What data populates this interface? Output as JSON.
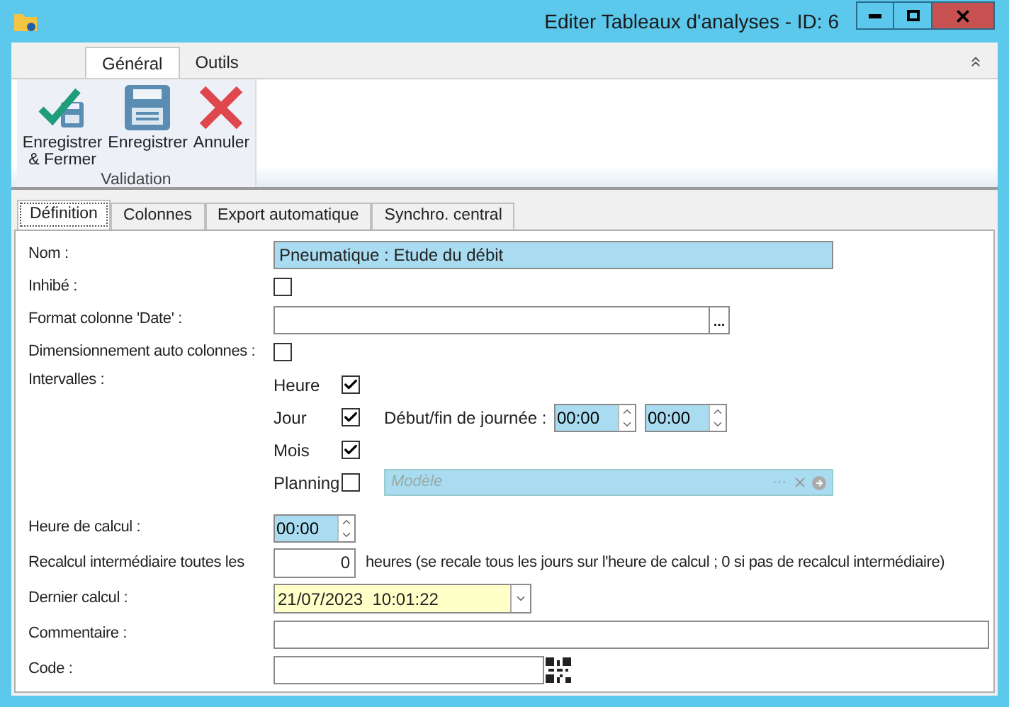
{
  "window": {
    "title": "Editer Tableaux d'analyses - ID: 6"
  },
  "ribbon": {
    "tabs": [
      {
        "label": "Général",
        "selected": true
      },
      {
        "label": "Outils",
        "selected": false
      }
    ],
    "groups": [
      {
        "label": "Validation",
        "buttons": [
          {
            "label": "Enregistrer\n& Fermer",
            "kind": "save_close"
          },
          {
            "label": "Enregistrer",
            "kind": "save"
          },
          {
            "label": "Annuler",
            "kind": "cancel"
          }
        ]
      }
    ]
  },
  "tabs": [
    {
      "label": "Définition",
      "selected": true
    },
    {
      "label": "Colonnes",
      "selected": false
    },
    {
      "label": "Export automatique",
      "selected": false
    },
    {
      "label": "Synchro. central",
      "selected": false
    }
  ],
  "fields": [
    {
      "kind": "text",
      "label": "Nom :",
      "value": "Pneumatique : Etude du débit",
      "highlighted": true
    },
    {
      "kind": "checkbox",
      "label": "Inhibé :",
      "checked": false
    },
    {
      "kind": "ellipsis",
      "label": "Format colonne 'Date' :",
      "button": "..."
    },
    {
      "kind": "checkbox",
      "label": "Dimensionnement auto colonnes :",
      "checked": false
    },
    {
      "kind": "intervals",
      "label": "Intervalles :",
      "items": [
        {
          "label": "Heure",
          "checked": true
        },
        {
          "label": "Jour",
          "checked": true,
          "bounds": {
            "label": "Début/fin de journée :",
            "start": "00:00",
            "end": "00:00"
          }
        },
        {
          "label": "Mois",
          "checked": true
        },
        {
          "label": "Planning",
          "checked": false,
          "model": {
            "placeholder": "Modèle",
            "button": "···"
          }
        }
      ]
    },
    {
      "kind": "time",
      "label": "Heure de calcul :",
      "value": "00:00"
    },
    {
      "kind": "number",
      "label": "Recalcul intermédiaire toutes les",
      "value": "0",
      "suffix": "heures (se recale tous les jours sur l'heure de calcul ; 0 si pas de recalcul intermédiaire)"
    },
    {
      "kind": "date",
      "label": "Dernier calcul :",
      "value": "21/07/2023  10:01:22"
    },
    {
      "kind": "wide_text",
      "label": "Commentaire :"
    },
    {
      "kind": "qr",
      "label": "Code :"
    }
  ]
}
